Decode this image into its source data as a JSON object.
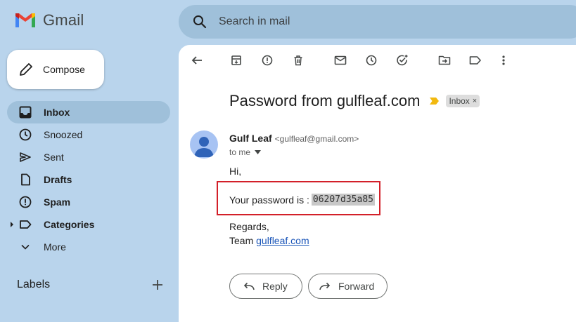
{
  "app": {
    "name": "Gmail"
  },
  "search": {
    "placeholder": "Search in mail"
  },
  "compose": {
    "label": "Compose"
  },
  "sidebar": {
    "items": [
      {
        "label": "Inbox",
        "icon": "inbox-icon",
        "active": true
      },
      {
        "label": "Snoozed",
        "icon": "clock-icon"
      },
      {
        "label": "Sent",
        "icon": "send-icon"
      },
      {
        "label": "Drafts",
        "icon": "draft-icon"
      },
      {
        "label": "Spam",
        "icon": "spam-icon"
      },
      {
        "label": "Categories",
        "icon": "label-icon"
      },
      {
        "label": "More",
        "icon": "chevron-down-icon"
      }
    ],
    "labels_heading": "Labels"
  },
  "email": {
    "subject": "Password from gulfleaf.com",
    "folder_chip": "Inbox",
    "chip_close": "×",
    "sender_name": "Gulf Leaf",
    "sender_email": "<gulfleaf@gmail.com>",
    "recipient": "to me",
    "greeting": "Hi,",
    "password_prefix": "Your password is :",
    "password": "06207d35a85",
    "closing": "Regards,",
    "signature_prefix": "Team",
    "signature_link": "gulfleaf.com"
  },
  "actions": {
    "reply": "Reply",
    "forward": "Forward"
  },
  "colors": {
    "background": "#b9d4ec",
    "search": "#9fc0da",
    "highlight_box": "#d32029",
    "link": "#1a55b8",
    "avatar": "#a7c3f3",
    "avatar_fg": "#2f63b8"
  }
}
